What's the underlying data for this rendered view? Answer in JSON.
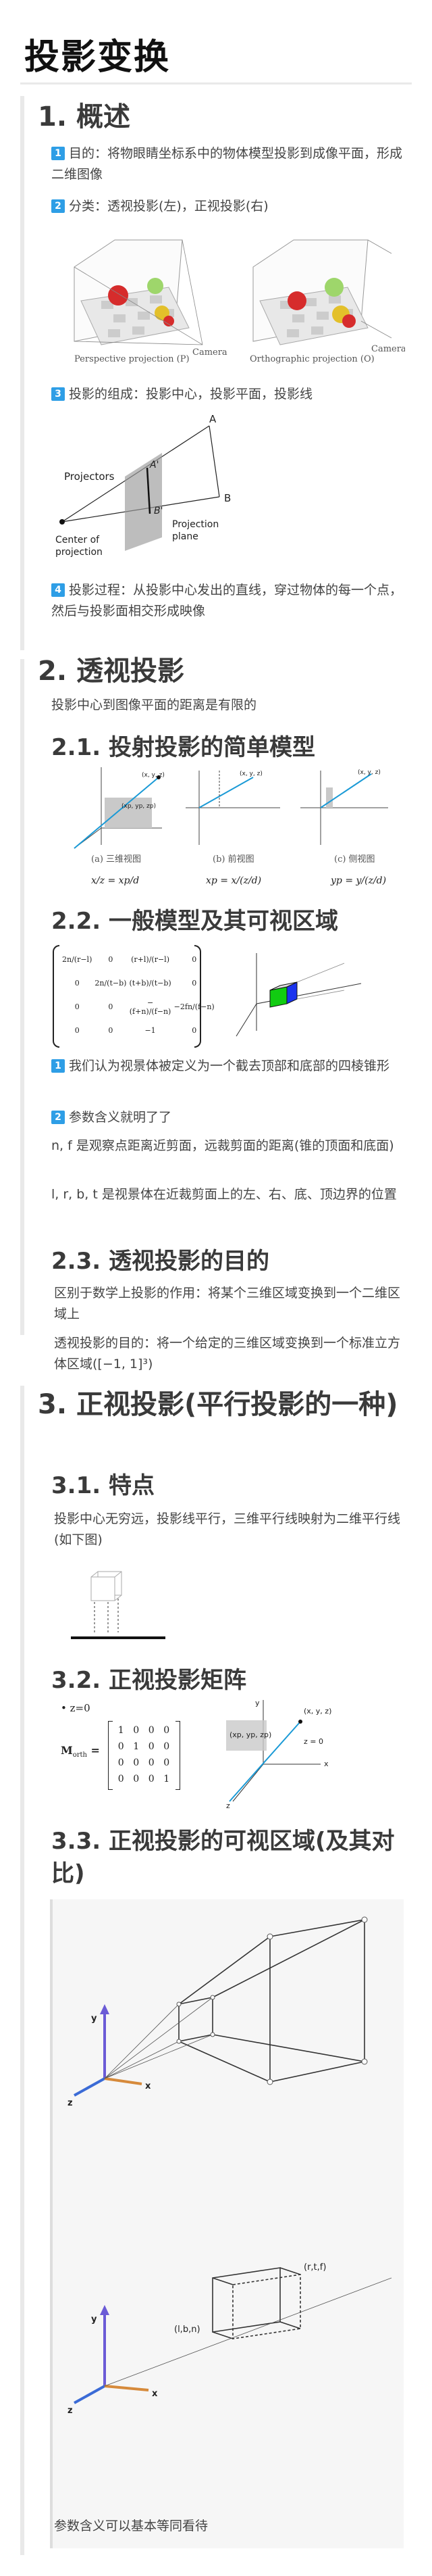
{
  "title": "投影变换",
  "s1": {
    "heading": "1. 概述",
    "item1": {
      "num": "1",
      "text": "目的：将物眼睛坐标系中的物体模型投影到成像平面，形成二维图像"
    },
    "item2": {
      "num": "2",
      "text": "分类：透视投影(左)，正视投影(右)"
    },
    "fig_persp_cap": "Perspective projection (P)",
    "fig_ortho_cap": "Orthographic projection (O)",
    "fig_cam_cap": "Camera",
    "item3": {
      "num": "3",
      "text": "投影的组成：投影中心，投影平面，投影线"
    },
    "proj_labels": {
      "projectors": "Projectors",
      "center1": "Center of",
      "center2": "projection",
      "plane1": "Projection",
      "plane2": "plane",
      "A": "A",
      "B": "B",
      "Ap": "A'",
      "Bp": "B'"
    },
    "item4": {
      "num": "4",
      "text": "投影过程：从投影中心发出的直线，穿过物体的每一个点，然后与投影面相交形成映像"
    }
  },
  "s2": {
    "heading": "2. 透视投影",
    "intro": "投影中心到图像平面的距离是有限的",
    "s21": {
      "heading": "2.1. 投射投影的简单模型",
      "caps": [
        "(a) 三维视图",
        "(b) 前视图",
        "(c) 侧视图"
      ],
      "pt_labels": [
        "(x, y, z)",
        "(xp, yp, zp)",
        "z = d"
      ],
      "eqs": [
        "x/z = xp/d",
        "xp = x/(z/d)",
        "yp = y/(z/d)"
      ]
    },
    "s22": {
      "heading": "2.2. 一般模型及其可视区域",
      "matrix": [
        [
          "2n/(r−l)",
          "0",
          "(r+l)/(r−l)",
          "0"
        ],
        [
          "0",
          "2n/(t−b)",
          "(t+b)/(t−b)",
          "0"
        ],
        [
          "0",
          "0",
          "−(f+n)/(f−n)",
          "−2fn/(f−n)"
        ],
        [
          "0",
          "0",
          "−1",
          "0"
        ]
      ],
      "item1": {
        "num": "1",
        "text": "我们认为视景体被定义为一个截去顶部和底部的四棱锥形"
      },
      "item2": {
        "num": "2",
        "text": "参数含义就明了了"
      },
      "p1": "n, f 是观察点距离近剪面，远裁剪面的距离(锥的顶面和底面)",
      "p2": "l, r, b, t 是视景体在近裁剪面上的左、右、底、顶边界的位置"
    },
    "s23": {
      "heading": "2.3. 透视投影的目的",
      "p1": "区别于数学上投影的作用：将某个三维区域变换到一个二维区域上",
      "p2": "透视投影的目的：将一个给定的三维区域变换到一个标准立方体区域([−1, 1]³)"
    }
  },
  "s3": {
    "heading": "3. 正视投影(平行投影的一种)",
    "s31": {
      "heading": "3.1. 特点",
      "p1": "投影中心无穷远，投影线平行，三维平行线映射为二维平行线(如下图)"
    },
    "s32": {
      "heading": "3.2. 正视投影矩阵",
      "zlabel": "• z=0",
      "mlabel": "M",
      "msub": "orth",
      "matrix": [
        [
          "1",
          "0",
          "0",
          "0"
        ],
        [
          "0",
          "1",
          "0",
          "0"
        ],
        [
          "0",
          "0",
          "0",
          "0"
        ],
        [
          "0",
          "0",
          "0",
          "1"
        ]
      ],
      "fig_labels": [
        "(x, y, z)",
        "(xp, yp, zp)",
        "z = 0",
        "x",
        "y",
        "z"
      ]
    },
    "s33": {
      "heading": "3.3. 正视投影的可视区域(及其对比)",
      "labels": [
        "y",
        "z",
        "x",
        "y",
        "z",
        "x",
        "(r,t,f)",
        "(l,b,n)"
      ],
      "footer": "参数含义可以基本等同看待"
    }
  }
}
